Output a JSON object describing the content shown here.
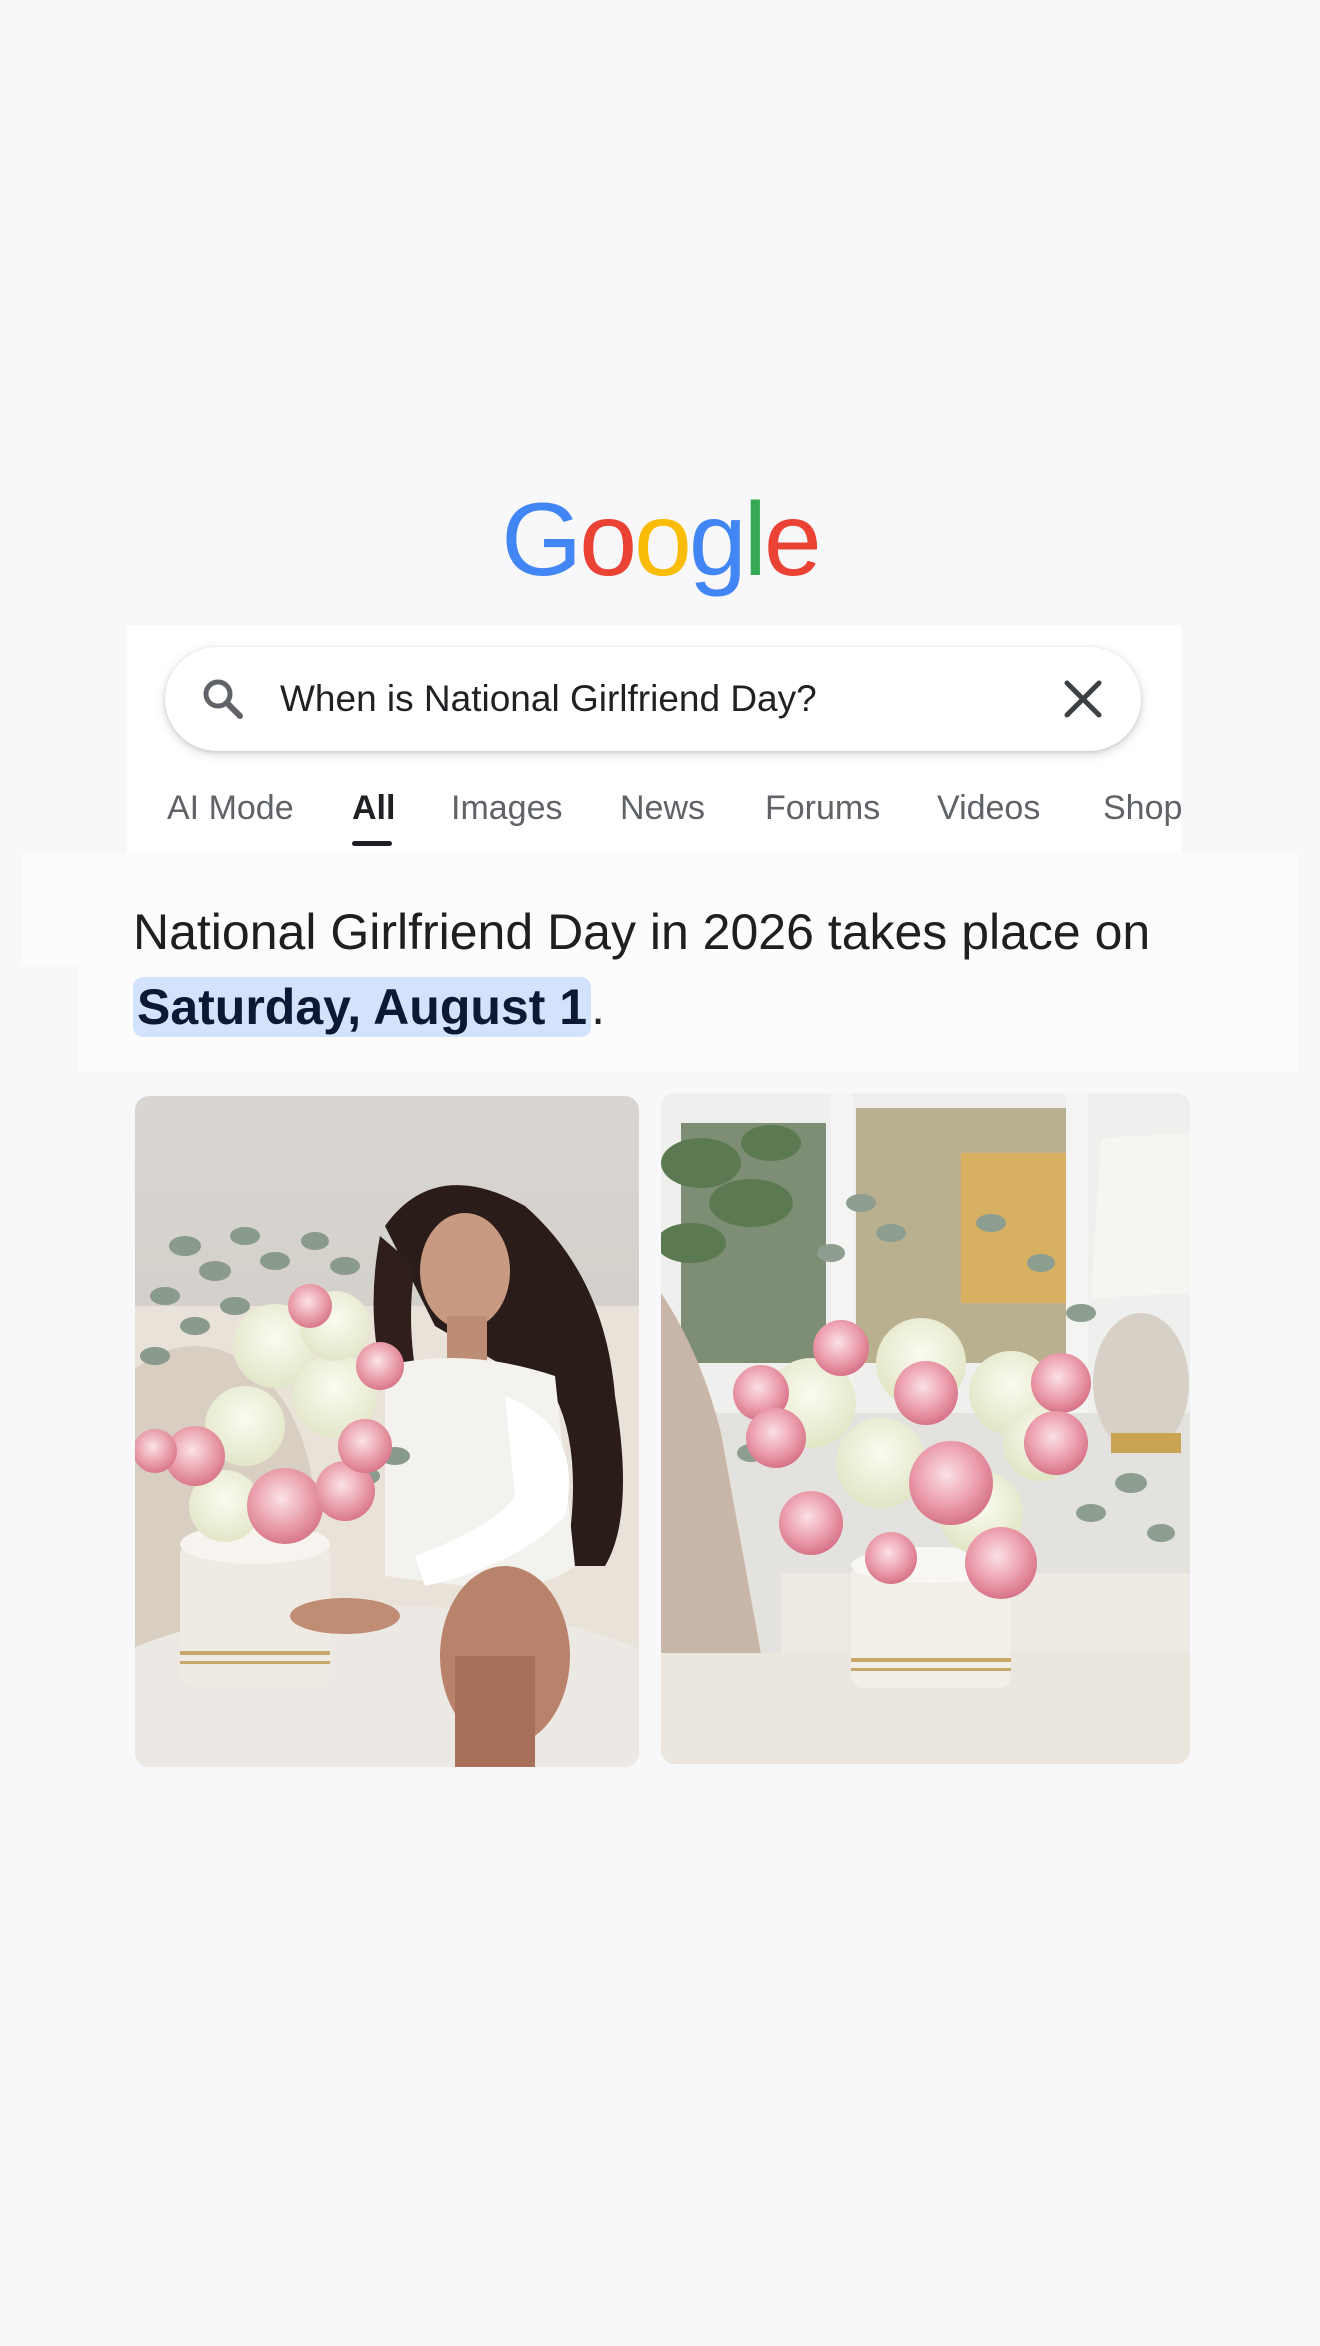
{
  "logo": {
    "letters": [
      "G",
      "o",
      "o",
      "g",
      "l",
      "e"
    ],
    "colors": [
      "#4285F4",
      "#EA4335",
      "#FBBC05",
      "#4285F4",
      "#34A853",
      "#EA4335"
    ]
  },
  "search": {
    "query": "When is National Girlfriend Day?",
    "search_icon": "search-icon",
    "clear_icon": "close-icon"
  },
  "tabs": [
    {
      "label": "AI Mode",
      "active": false
    },
    {
      "label": "All",
      "active": true
    },
    {
      "label": "Images",
      "active": false
    },
    {
      "label": "News",
      "active": false
    },
    {
      "label": "Forums",
      "active": false
    },
    {
      "label": "Videos",
      "active": false
    },
    {
      "label": "Shop",
      "active": false
    }
  ],
  "answer": {
    "text_before": "National Girlfriend Day in 2026 takes place on ",
    "highlight": "Saturday, August 1",
    "text_after": "."
  },
  "images": [
    {
      "name": "woman-holding-flower-bouquet-photo"
    },
    {
      "name": "flower-arrangement-by-window-photo"
    }
  ],
  "colors": {
    "page_background": "#f8f8fa",
    "highlight": "#d3e3fd",
    "active_tab": "#202124",
    "inactive_tab": "#5f6368"
  }
}
